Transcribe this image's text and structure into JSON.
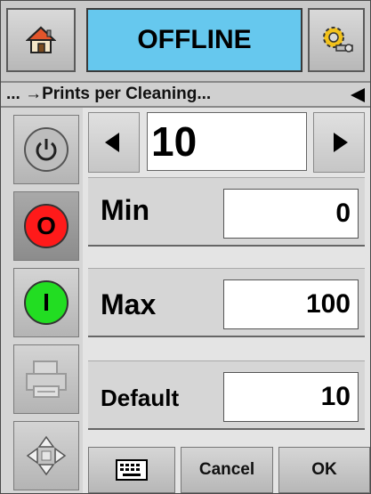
{
  "header": {
    "status": "OFFLINE",
    "home_icon": "home-icon",
    "settings_icon": "gear-wrench-icon"
  },
  "breadcrumb": {
    "text": "... →Prints per Cleaning..."
  },
  "sidebar": {
    "items": [
      {
        "icon": "power-icon",
        "label": ""
      },
      {
        "icon": "stop-icon",
        "label": "O",
        "color": "#ff1a1a"
      },
      {
        "icon": "start-icon",
        "label": "I",
        "color": "#22dd22"
      },
      {
        "icon": "printer-icon",
        "label": ""
      },
      {
        "icon": "navigation-arrows-icon",
        "label": ""
      }
    ]
  },
  "editor": {
    "value": "10",
    "min_label": "Min",
    "min_value": "0",
    "max_label": "Max",
    "max_value": "100",
    "default_label": "Default",
    "default_value": "10"
  },
  "footer": {
    "keyboard_icon": "keyboard-icon",
    "cancel_label": "Cancel",
    "ok_label": "OK"
  }
}
